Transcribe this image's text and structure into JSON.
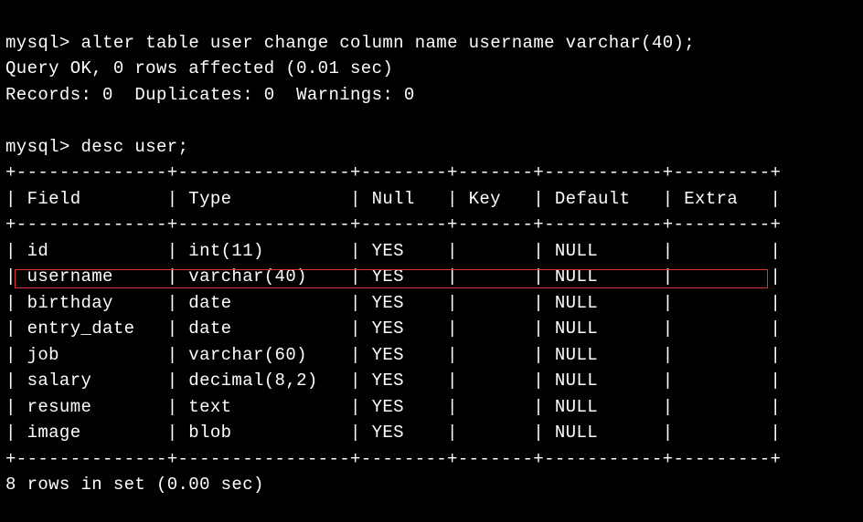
{
  "prompt": "mysql>",
  "commands": {
    "alter": "alter table user change column name username varchar(40);",
    "desc": "desc user;"
  },
  "alter_result": {
    "line1": "Query OK, 0 rows affected (0.01 sec)",
    "line2": "Records: 0  Duplicates: 0  Warnings: 0"
  },
  "table": {
    "columns": [
      "Field",
      "Type",
      "Null",
      "Key",
      "Default",
      "Extra"
    ],
    "widths": [
      12,
      14,
      6,
      5,
      9,
      7
    ],
    "rows": [
      {
        "Field": "id",
        "Type": "int(11)",
        "Null": "YES",
        "Key": "",
        "Default": "NULL",
        "Extra": ""
      },
      {
        "Field": "username",
        "Type": "varchar(40)",
        "Null": "YES",
        "Key": "",
        "Default": "NULL",
        "Extra": ""
      },
      {
        "Field": "birthday",
        "Type": "date",
        "Null": "YES",
        "Key": "",
        "Default": "NULL",
        "Extra": ""
      },
      {
        "Field": "entry_date",
        "Type": "date",
        "Null": "YES",
        "Key": "",
        "Default": "NULL",
        "Extra": ""
      },
      {
        "Field": "job",
        "Type": "varchar(60)",
        "Null": "YES",
        "Key": "",
        "Default": "NULL",
        "Extra": ""
      },
      {
        "Field": "salary",
        "Type": "decimal(8,2)",
        "Null": "YES",
        "Key": "",
        "Default": "NULL",
        "Extra": ""
      },
      {
        "Field": "resume",
        "Type": "text",
        "Null": "YES",
        "Key": "",
        "Default": "NULL",
        "Extra": ""
      },
      {
        "Field": "image",
        "Type": "blob",
        "Null": "YES",
        "Key": "",
        "Default": "NULL",
        "Extra": ""
      }
    ],
    "footer": "8 rows in set (0.00 sec)",
    "highlight_row_index": 1
  }
}
